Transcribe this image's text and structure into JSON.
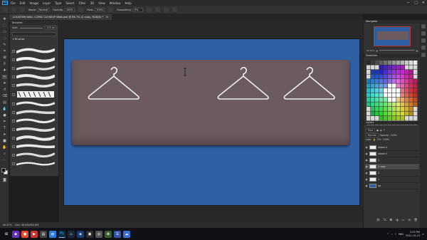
{
  "app": {
    "logo": "Ps"
  },
  "menubar": {
    "items": [
      "File",
      "Edit",
      "Image",
      "Layer",
      "Type",
      "Select",
      "Filter",
      "3D",
      "View",
      "Window",
      "Help"
    ],
    "window_controls": [
      "—",
      "□",
      "✕"
    ]
  },
  "options": {
    "mode_label": "Mode:",
    "mode_value": "Normal",
    "opacity_label": "Opacity:",
    "opacity_value": "100%",
    "flow_label": "Flow:",
    "flow_value": "100%",
    "smoothing_label": "Smoothing:",
    "smoothing_value": "0%"
  },
  "document": {
    "tab_title": "LOCATION WALL COMIC CLOSEUP Walk.psd @ 66.7% (2 copy, RGB/8) *",
    "close_glyph": "✕"
  },
  "brushes_panel": {
    "title": "Brushes",
    "size_label": "Size:",
    "size_value": "125 px",
    "folder_label": "Brushes"
  },
  "canvas": {
    "artboard_color": "#2f5fa3",
    "rail_color": "#6b5a5e",
    "hanger_count": 3,
    "hanger_stroke": "#f2eef0"
  },
  "navigator": {
    "title": "Navigator",
    "zoom_value": "66.67%"
  },
  "swatches": {
    "title": "Swatches"
  },
  "layers": {
    "title": "Layers",
    "kind_label": "Kind",
    "blend_value": "Normal",
    "opacity_label": "Opacity:",
    "opacity_value": "100%",
    "lock_label": "Lock:",
    "fill_label": "Fill:",
    "fill_value": "100%",
    "rows": [
      {
        "name": "stroke 4",
        "selected": false,
        "blue": false
      },
      {
        "name": "stroke 3",
        "selected": false,
        "blue": false
      },
      {
        "name": "1",
        "selected": false,
        "blue": false
      },
      {
        "name": "2 copy",
        "selected": true,
        "blue": false
      },
      {
        "name": "2",
        "selected": false,
        "blue": false
      },
      {
        "name": "1",
        "selected": false,
        "blue": false
      },
      {
        "name": "bg",
        "selected": false,
        "blue": true
      }
    ]
  },
  "statusbar": {
    "zoom": "66.67%",
    "info": "Doc: 46.8M/483.6M"
  },
  "taskbar": {
    "lang": "ENG",
    "time": "2:55 PM",
    "date": "2021-10-13"
  },
  "colors": {
    "ps_blue": "#31a8ff",
    "selection": "#4a4a4a"
  }
}
